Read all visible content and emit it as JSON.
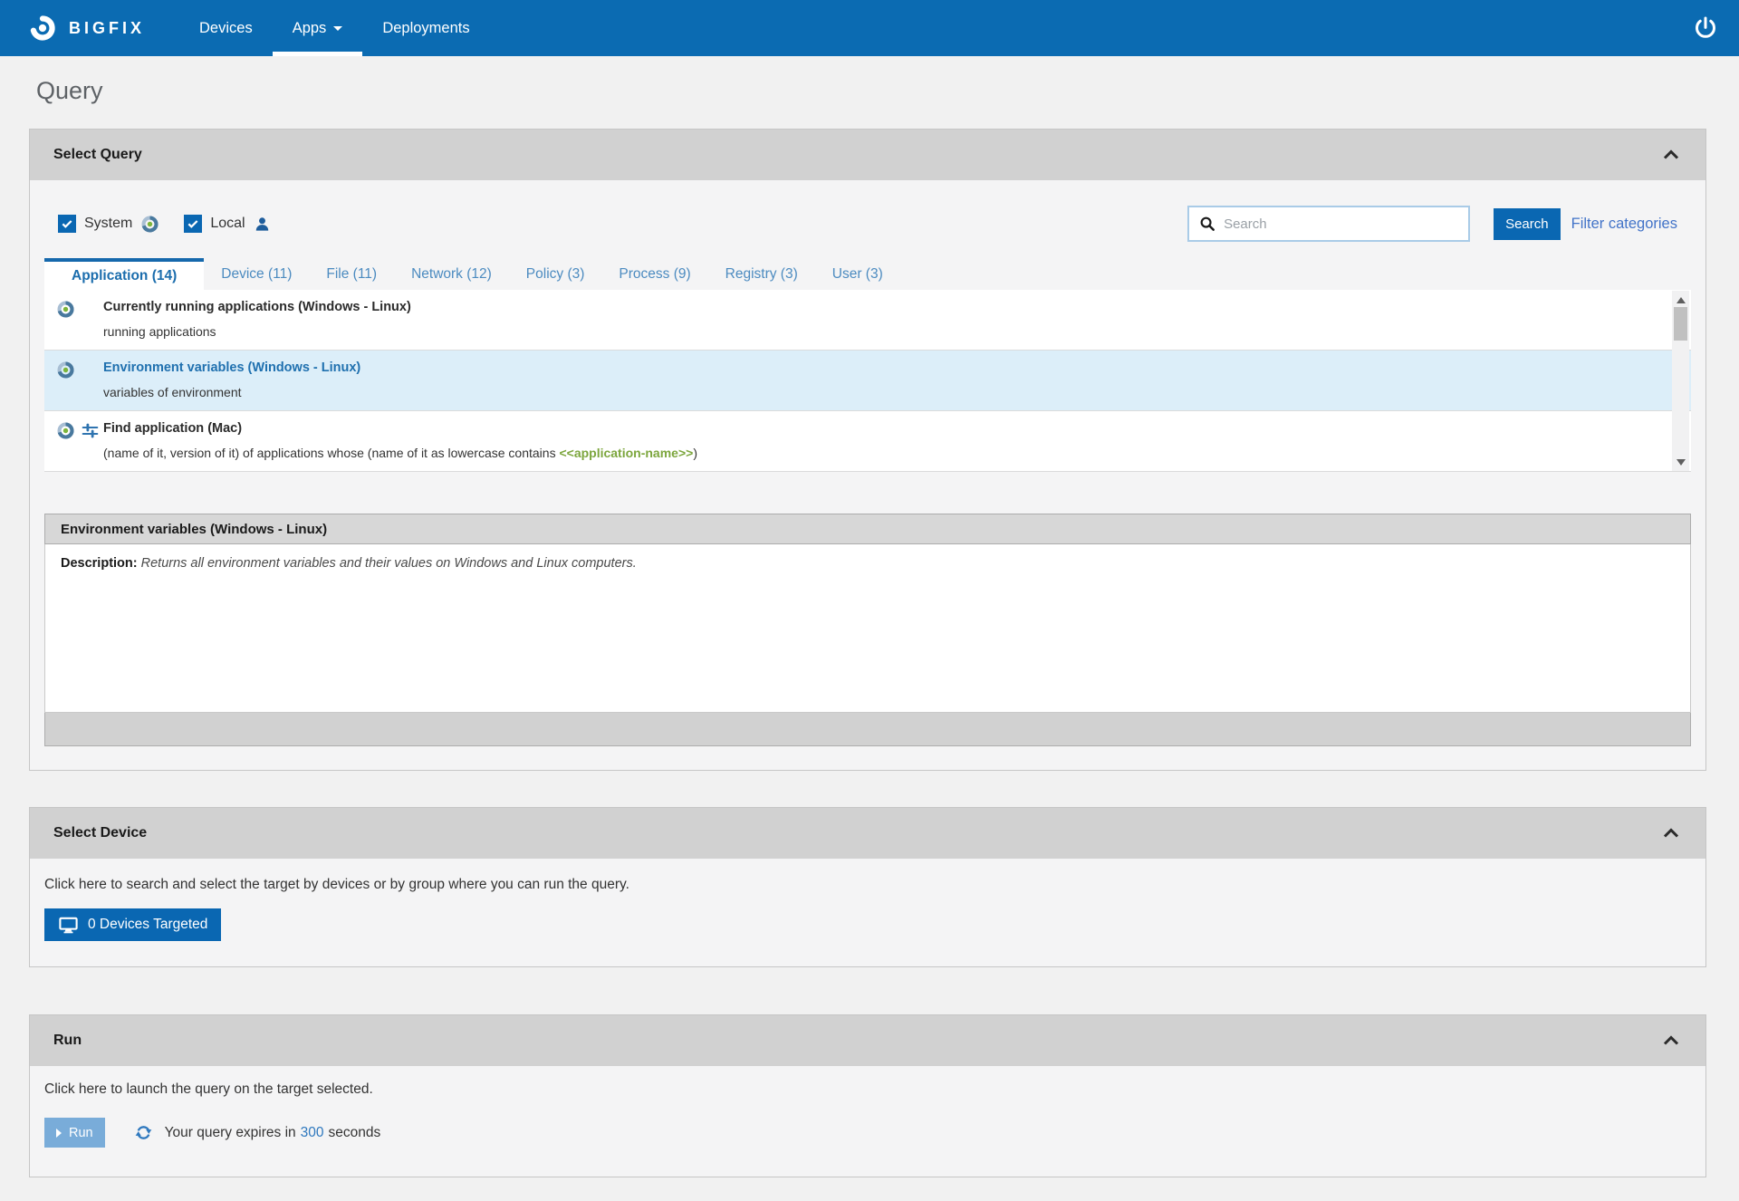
{
  "nav": {
    "brand": "BIGFIX",
    "items": [
      {
        "label": "Devices",
        "active": false
      },
      {
        "label": "Apps",
        "active": true
      },
      {
        "label": "Deployments",
        "active": false
      }
    ]
  },
  "page_title": "Query",
  "select_query": {
    "title": "Select Query",
    "filters": [
      {
        "label": "System",
        "checked": true,
        "icon": "bigfix-badge-icon"
      },
      {
        "label": "Local",
        "checked": true,
        "icon": "person-icon"
      }
    ],
    "search": {
      "placeholder": "Search",
      "button_label": "Search",
      "filter_link": "Filter categories"
    },
    "tabs": [
      {
        "label": "Application (14)",
        "active": true
      },
      {
        "label": "Device (11)",
        "active": false
      },
      {
        "label": "File (11)",
        "active": false
      },
      {
        "label": "Network (12)",
        "active": false
      },
      {
        "label": "Policy (3)",
        "active": false
      },
      {
        "label": "Process (9)",
        "active": false
      },
      {
        "label": "Registry (3)",
        "active": false
      },
      {
        "label": "User (3)",
        "active": false
      }
    ],
    "queries": [
      {
        "title": "Currently running applications (Windows - Linux)",
        "subtitle": "running applications",
        "selected": false
      },
      {
        "title": "Environment variables (Windows - Linux)",
        "subtitle": "variables of environment",
        "selected": true
      },
      {
        "title": "Find application (Mac)",
        "subtitle_prefix": "(name of it, version of it) of applications whose (name of it as lowercase contains ",
        "subtitle_param": "<<application-name>>",
        "subtitle_suffix": ")",
        "selected": false
      }
    ],
    "detail": {
      "title": "Environment variables (Windows - Linux)",
      "description_label": "Description:",
      "description_text": "Returns all environment variables and their values on Windows and Linux computers."
    }
  },
  "select_device": {
    "title": "Select Device",
    "instruction": "Click here to search and select the target by devices or by group where you can run the query.",
    "button_label": "0 Devices Targeted"
  },
  "run": {
    "title": "Run",
    "instruction": "Click here to launch the query on the target selected.",
    "button_label": "Run",
    "expiry_prefix": "Your query expires in",
    "expiry_seconds": "300",
    "expiry_suffix": "seconds"
  },
  "icons": {
    "brand": "bigfix-logo-icon",
    "nav_active_caret": "caret-down-icon",
    "logout": "power-icon",
    "system_filter": "bigfix-badge-icon",
    "local_filter": "person-icon",
    "search": "search-icon",
    "query_item": "bigfix-badge-icon",
    "query_parameters": "sliders-icon",
    "panel_collapse": "chevron-up-icon",
    "devices_button": "monitor-icon",
    "run_refresh": "refresh-icon",
    "run_play": "play-icon"
  },
  "colors": {
    "navbg": "#0B6BB2",
    "accent": "#0A67B2",
    "link": "#4273C8",
    "green": "#7CA63D",
    "selbg": "#DCEEF9",
    "seltitle": "#1F70AF",
    "runbtn": "#79ACD9",
    "tabactive": "#1B6DAD",
    "tabinactive": "#4C8BC0",
    "tabborder": "#1568AC"
  }
}
